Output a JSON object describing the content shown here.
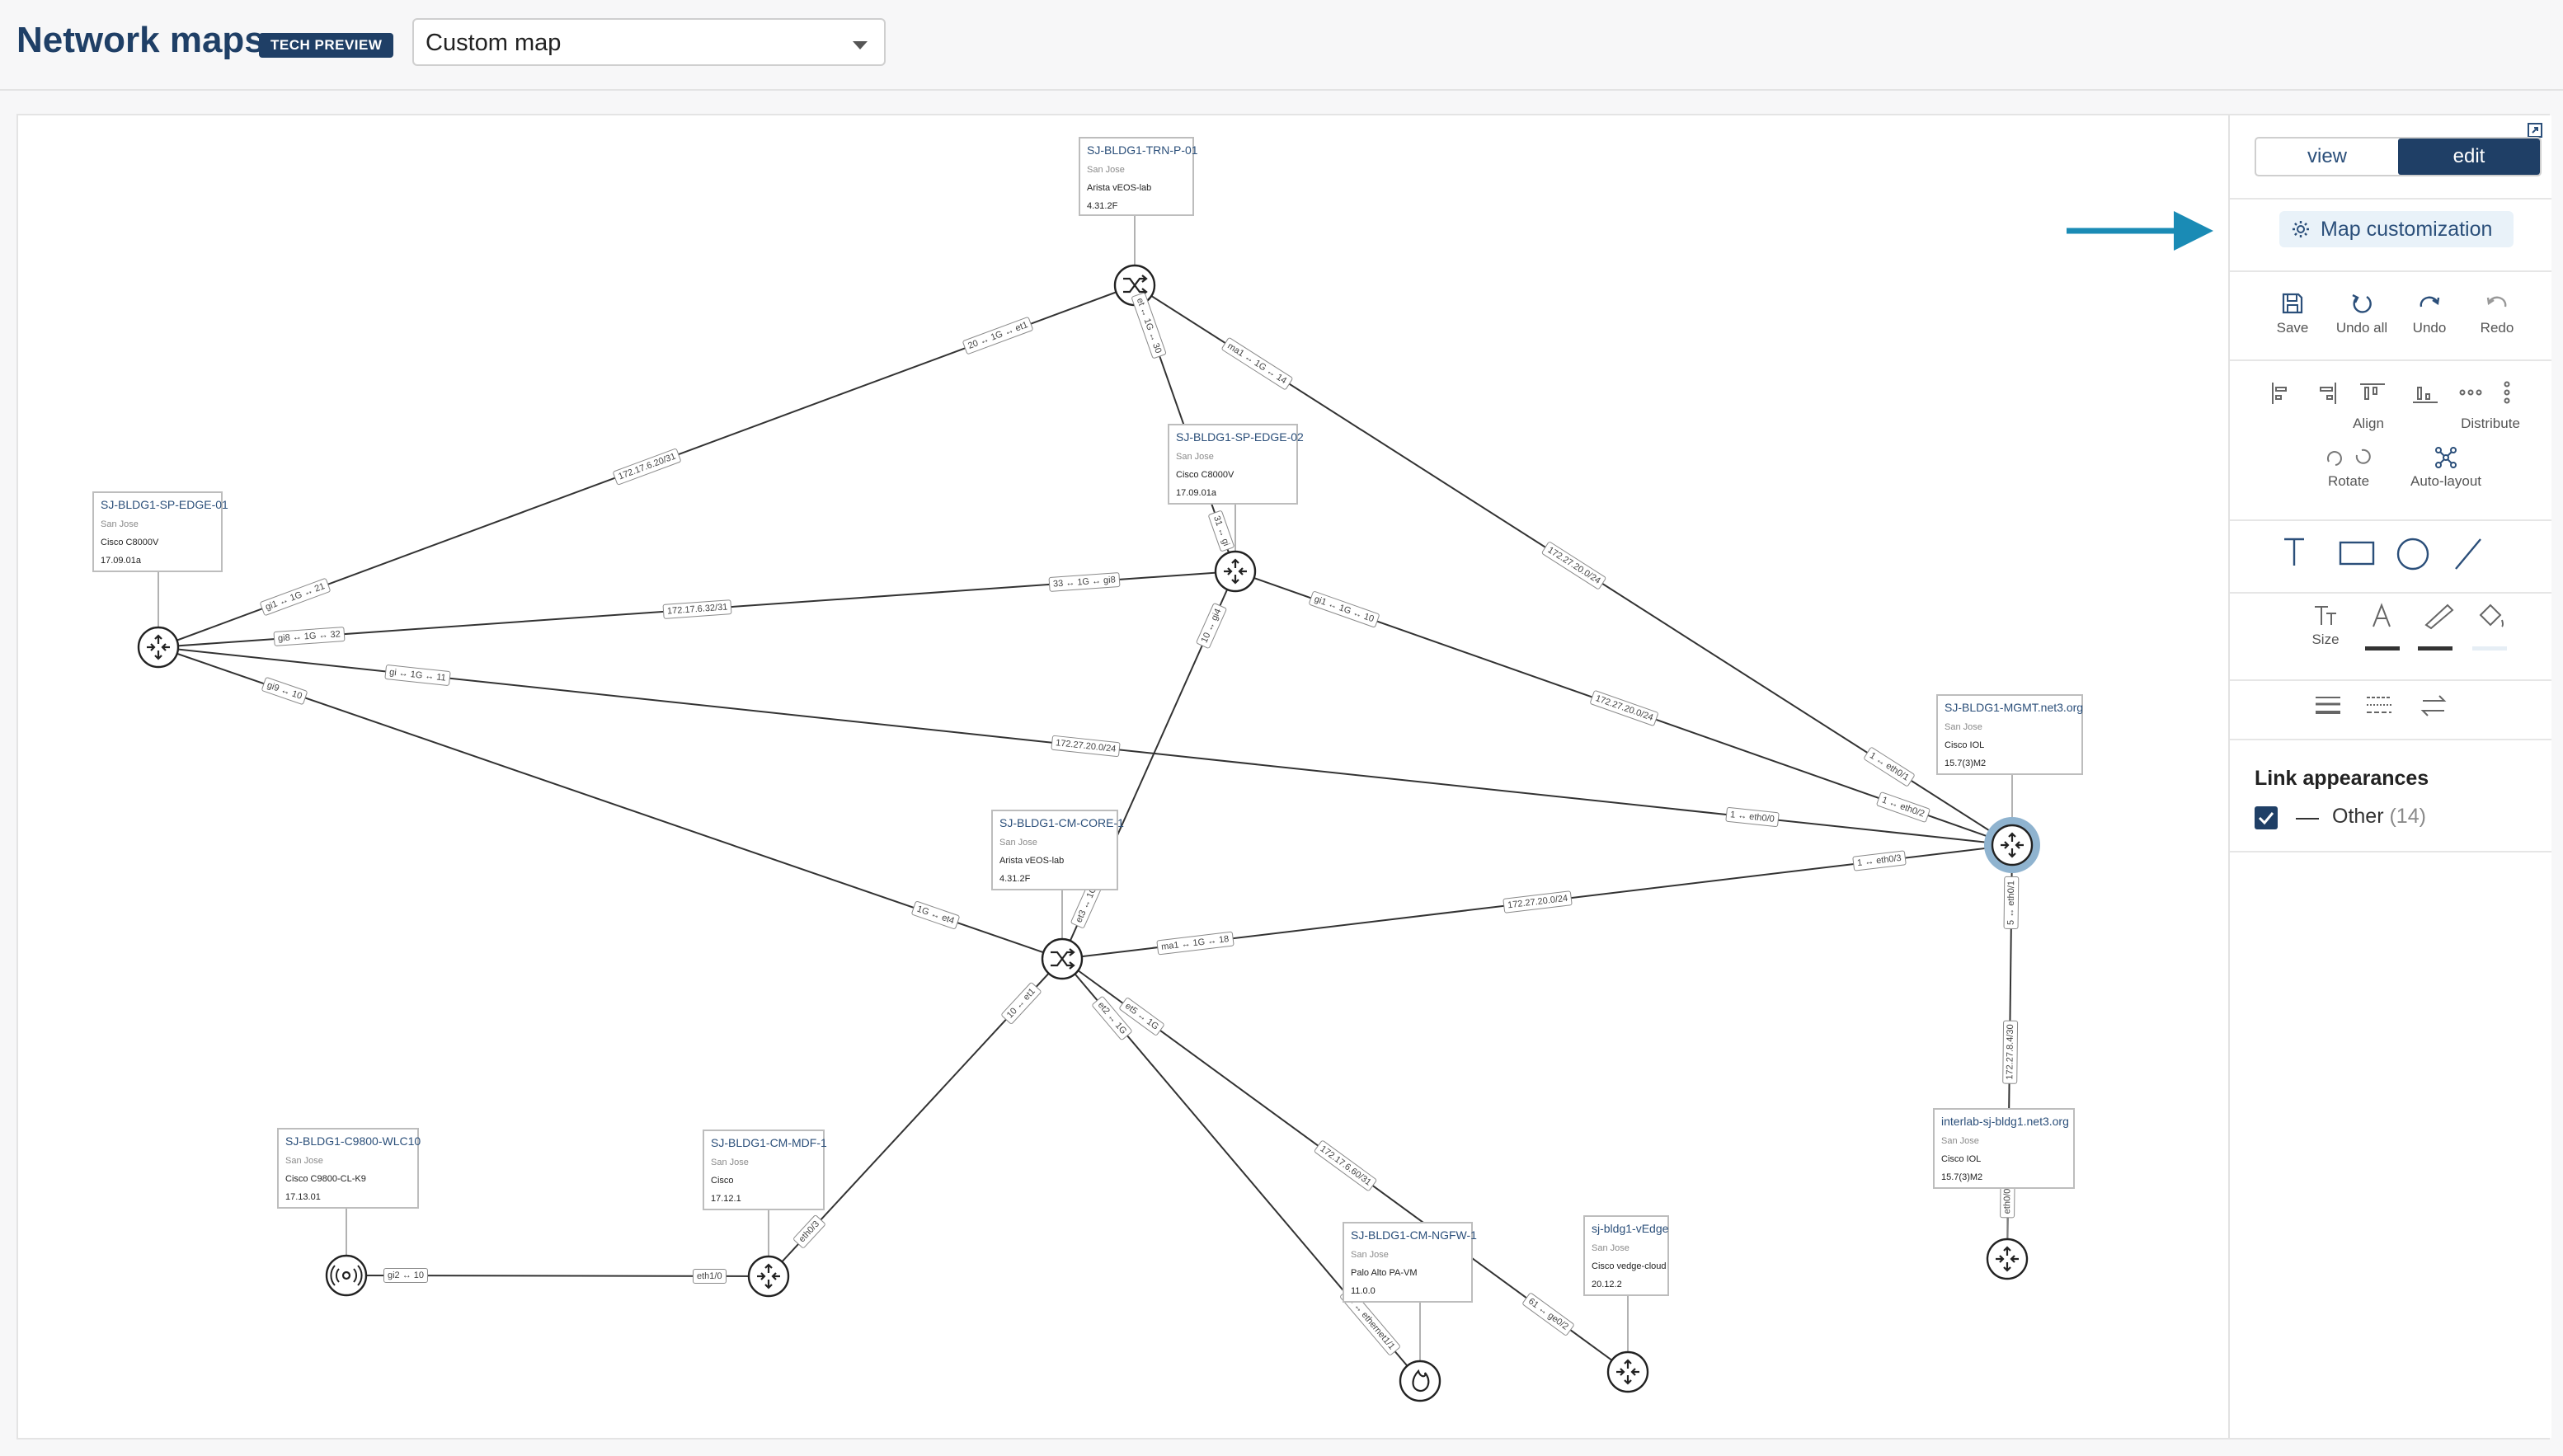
{
  "header": {
    "title": "Network maps",
    "badge": "TECH PREVIEW",
    "map_select": {
      "value": "Custom map"
    }
  },
  "panel": {
    "modes": [
      "view",
      "edit"
    ],
    "active_mode": "edit",
    "customize_label": "Map customization",
    "history_tools": [
      {
        "label": "Save",
        "icon": "save-icon"
      },
      {
        "label": "Undo all",
        "icon": "undo-all-icon"
      },
      {
        "label": "Undo",
        "icon": "undo-icon"
      },
      {
        "label": "Redo",
        "icon": "redo-icon"
      }
    ],
    "align_label": "Align",
    "distribute_label": "Distribute",
    "rotate_label": "Rotate",
    "autolayout_label": "Auto-layout",
    "size_label": "Size",
    "link_appearances": {
      "title": "Link appearances",
      "items": [
        {
          "label": "Other",
          "count": "(14)",
          "checked": true
        }
      ]
    }
  },
  "map": {
    "nodes": [
      {
        "id": "trn",
        "name": "SJ-BLDG1-TRN-P-01",
        "location": "San Jose",
        "model": "Arista vEOS-lab",
        "version": "4.31.2F",
        "icon": "switch-icon"
      },
      {
        "id": "edge01",
        "name": "SJ-BLDG1-SP-EDGE-01",
        "location": "San Jose",
        "model": "Cisco C8000V",
        "version": "17.09.01a",
        "icon": "router-icon"
      },
      {
        "id": "edge02",
        "name": "SJ-BLDG1-SP-EDGE-02",
        "location": "San Jose",
        "model": "Cisco C8000V",
        "version": "17.09.01a",
        "icon": "router-icon"
      },
      {
        "id": "mgmt",
        "name": "SJ-BLDG1-MGMT.net3.org",
        "location": "San Jose",
        "model": "Cisco IOL",
        "version": "15.7(3)M2",
        "icon": "router-icon"
      },
      {
        "id": "core",
        "name": "SJ-BLDG1-CM-CORE-1",
        "location": "San Jose",
        "model": "Arista vEOS-lab",
        "version": "4.31.2F",
        "icon": "switch-icon"
      },
      {
        "id": "wlc",
        "name": "SJ-BLDG1-C9800-WLC10",
        "location": "San Jose",
        "model": "Cisco C9800-CL-K9",
        "version": "17.13.01",
        "icon": "wireless-controller-icon"
      },
      {
        "id": "mdf",
        "name": "SJ-BLDG1-CM-MDF-1",
        "location": "San Jose",
        "model": "Cisco",
        "version": "17.12.1",
        "icon": "router-icon"
      },
      {
        "id": "ngfw",
        "name": "SJ-BLDG1-CM-NGFW-1",
        "location": "San Jose",
        "model": "Palo Alto PA-VM",
        "version": "11.0.0",
        "icon": "firewall-icon"
      },
      {
        "id": "vedge",
        "name": "sj-bldg1-vEdge",
        "location": "San Jose",
        "model": "Cisco vedge-cloud",
        "version": "20.12.2",
        "icon": "router-icon"
      },
      {
        "id": "interlab",
        "name": "interlab-sj-bldg1.net3.org",
        "location": "San Jose",
        "model": "Cisco IOL",
        "version": "15.7(3)M2",
        "icon": "router-icon"
      }
    ],
    "links": [
      {
        "from": "edge01",
        "to": "trn",
        "subnet": "172.17.6.20/31",
        "a_end": "gi1 ↔ 1G ↔ 21",
        "b_end": "20 ↔ 1G ↔ et1"
      },
      {
        "from": "edge01",
        "to": "edge02",
        "subnet": "172.17.6.32/31",
        "a_end": "gi8 ↔ 1G ↔ 32",
        "b_end": "33 ↔ 1G ↔ gi8"
      },
      {
        "from": "edge01",
        "to": "mgmt",
        "subnet": "172.27.20.0/24",
        "a_end": "gi ↔ 1G ↔ 11",
        "b_end": "1 ↔ eth0/0"
      },
      {
        "from": "edge01",
        "to": "core",
        "subnet": "",
        "a_end": "gi9 ↔ 10",
        "b_end": "1G ↔ et4"
      },
      {
        "from": "trn",
        "to": "edge02",
        "subnet": "",
        "a_end": "et ↔ 1G ↔ 30",
        "b_end": "31 ↔ gi"
      },
      {
        "from": "trn",
        "to": "mgmt",
        "subnet": "172.27.20.0/24",
        "a_end": "ma1 ↔ 1G ↔ 14",
        "b_end": "1 ↔ eth0/1"
      },
      {
        "from": "edge02",
        "to": "mgmt",
        "subnet": "172.27.20.0/24",
        "a_end": "gi1 ↔ 1G ↔ 10",
        "b_end": "1 ↔ eth0/2"
      },
      {
        "from": "edge02",
        "to": "core",
        "subnet": "",
        "a_end": "10 ↔ gi4",
        "b_end": "et3 ↔ 1G"
      },
      {
        "from": "core",
        "to": "mgmt",
        "subnet": "172.27.20.0/24",
        "a_end": "ma1 ↔ 1G ↔ 18",
        "b_end": "1 ↔ eth0/3"
      },
      {
        "from": "core",
        "to": "mdf",
        "subnet": "",
        "a_end": "10 ↔ et1",
        "b_end": "eth0/3"
      },
      {
        "from": "core",
        "to": "ngfw",
        "subnet": "",
        "a_end": "et2 ↔ 1G",
        "b_end": "10 ↔ ethernet1/1"
      },
      {
        "from": "core",
        "to": "vedge",
        "subnet": "172.17.6.60/31",
        "a_end": "et5 ↔ 1G",
        "b_end": "61 ↔ ge0/2"
      },
      {
        "from": "wlc",
        "to": "mdf",
        "subnet": "",
        "a_end": "gi2 ↔ 10",
        "b_end": "eth1/0"
      },
      {
        "from": "mgmt",
        "to": "interlab",
        "subnet": "172.27.8.4/30",
        "a_end": "5 ↔ eth0/1",
        "b_end": "eth0/0"
      }
    ]
  },
  "colors": {
    "title": "#1f3f66",
    "accent": "#1f3f66",
    "arrow": "#1a8bb5",
    "selected_ring": "#8fb3cf"
  }
}
